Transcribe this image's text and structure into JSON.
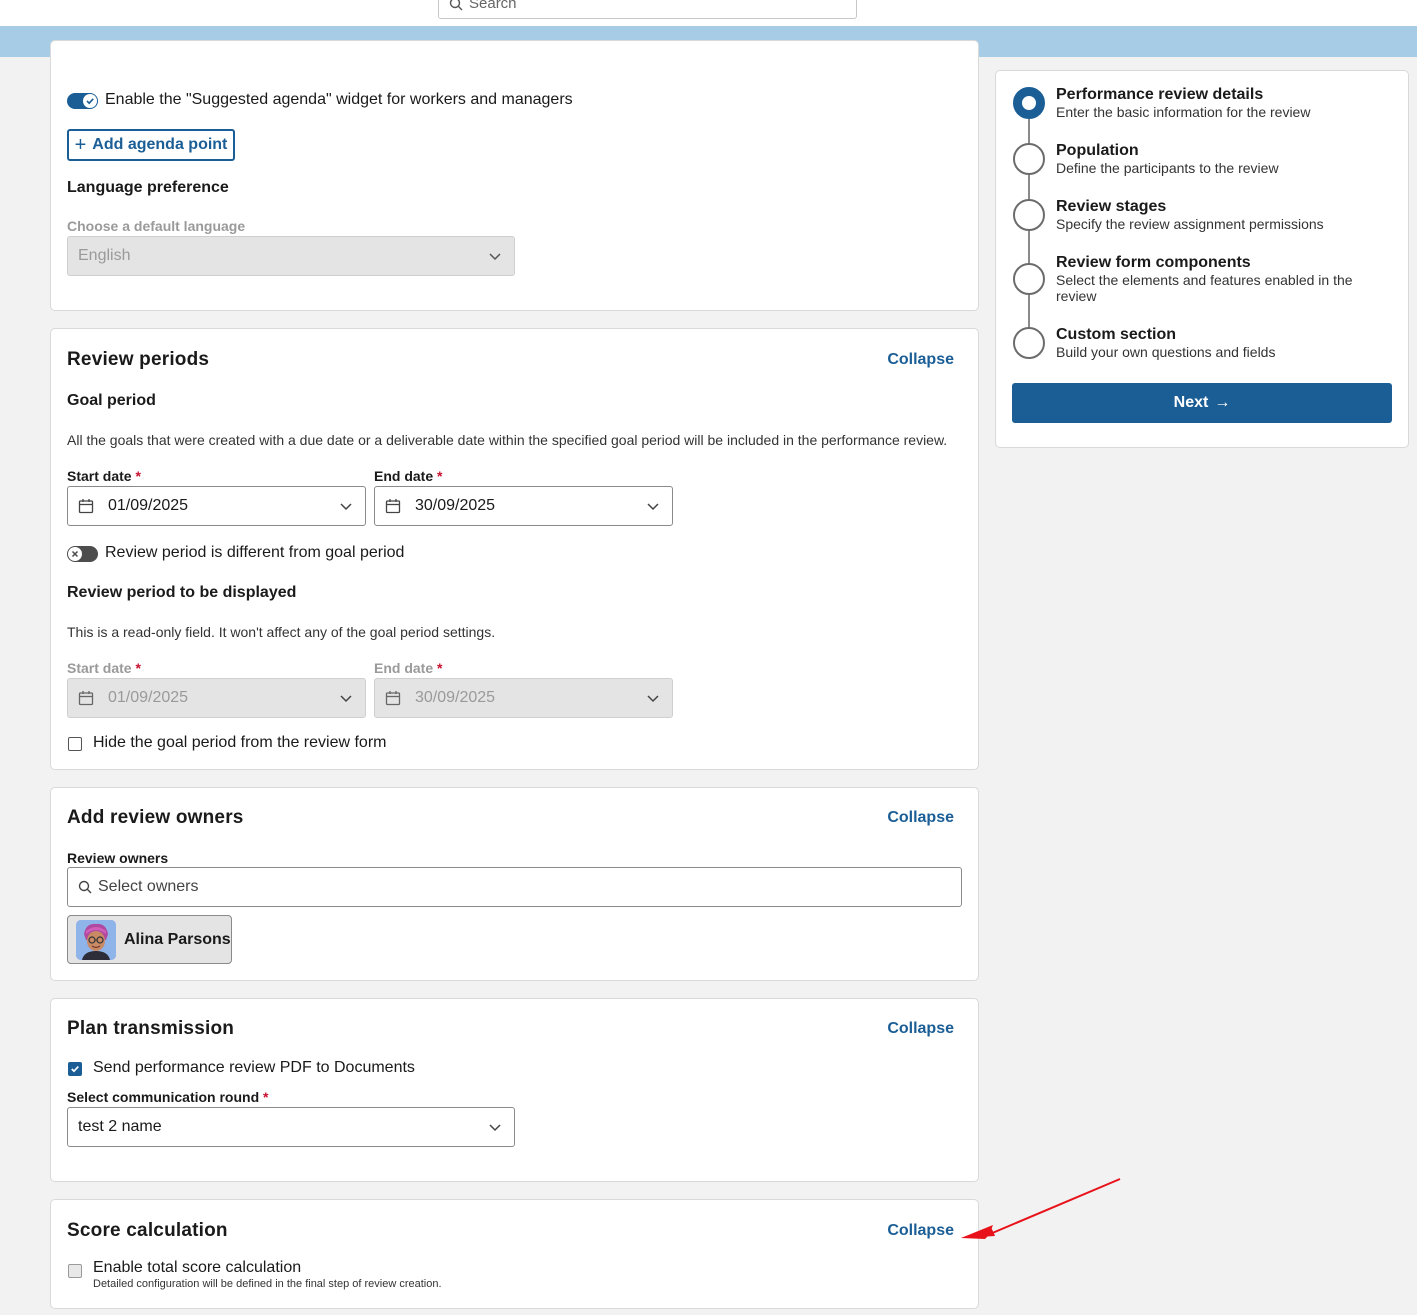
{
  "topbar": {
    "search_placeholder": "Search"
  },
  "agenda": {
    "toggle_label": "Enable the \"Suggested agenda\" widget for workers and managers",
    "add_button": "Add agenda point",
    "language_title": "Language preference",
    "language_label": "Choose a default language",
    "language_value": "English"
  },
  "review_periods": {
    "title": "Review periods",
    "collapse": "Collapse",
    "goal_title": "Goal period",
    "goal_desc": "All the goals that were created with a due date or a deliverable date within the specified goal period will be included in the performance review.",
    "start_label": "Start date",
    "end_label": "End date",
    "start_value": "01/09/2025",
    "end_value": "30/09/2025",
    "different_toggle": "Review period is different from goal period",
    "display_title": "Review period to be displayed",
    "display_desc": "This is a read-only field. It won't affect any of the goal period settings.",
    "display_start_label": "Start date",
    "display_end_label": "End date",
    "display_start_value": "01/09/2025",
    "display_end_value": "30/09/2025",
    "hide_checkbox": "Hide the goal period from the review form",
    "required_mark": "*"
  },
  "owners": {
    "title": "Add review owners",
    "collapse": "Collapse",
    "label": "Review owners",
    "placeholder": "Select owners",
    "chip_name": "Alina Parsons"
  },
  "plan": {
    "title": "Plan transmission",
    "collapse": "Collapse",
    "checkbox": "Send performance review PDF to Documents",
    "round_label": "Select communication round",
    "round_value": "test 2 name"
  },
  "score": {
    "title": "Score calculation",
    "collapse": "Collapse",
    "checkbox": "Enable total score calculation",
    "checkbox_desc": "Detailed configuration will be defined in the final step of review creation."
  },
  "stepper": {
    "steps": [
      {
        "title": "Performance review details",
        "desc": "Enter the basic information for the review"
      },
      {
        "title": "Population",
        "desc": "Define the participants to the review"
      },
      {
        "title": "Review stages",
        "desc": "Specify the review assignment permissions"
      },
      {
        "title": "Review form components",
        "desc": "Select the elements and features enabled in the review"
      },
      {
        "title": "Custom section",
        "desc": "Build your own questions and fields"
      }
    ],
    "next": "Next"
  },
  "colors": {
    "primary": "#1b5e96",
    "band": "#a6cde5",
    "annotation": "#e8121a"
  }
}
